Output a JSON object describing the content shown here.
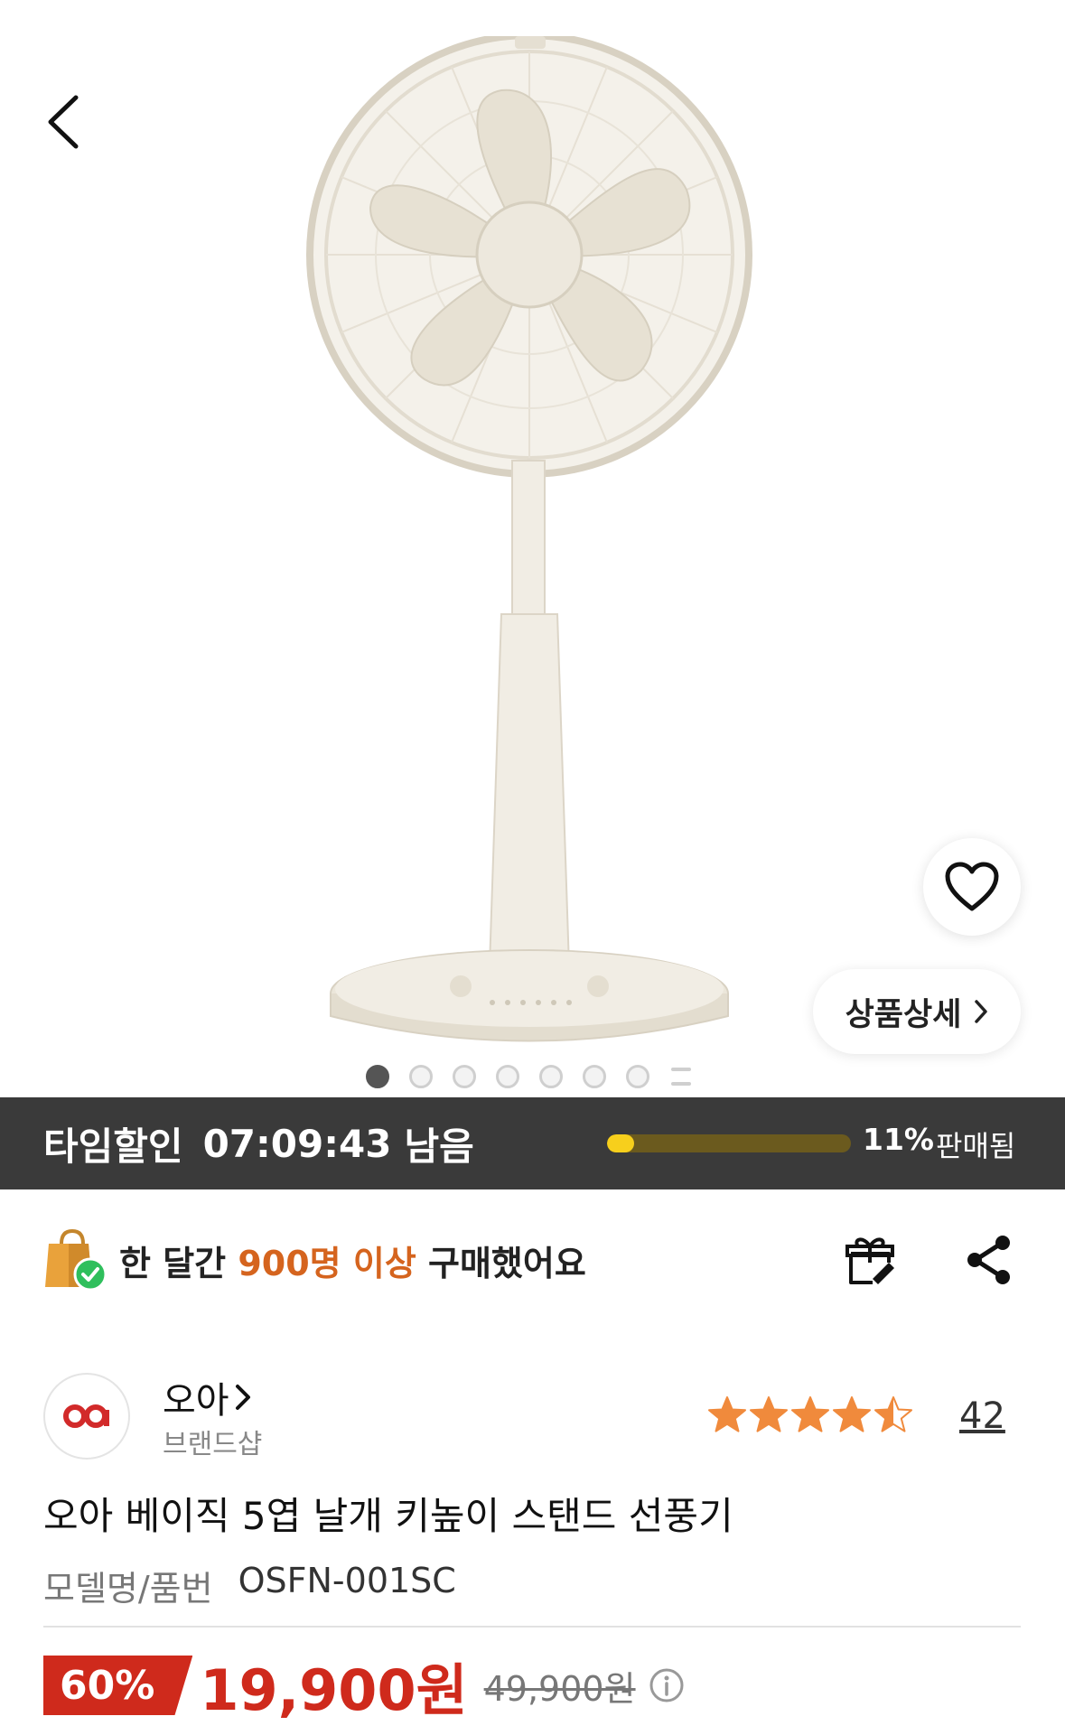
{
  "hero": {
    "image_alt": "오아 베이직 5엽 날개 키높이 스탠드 선풍기",
    "detail_button_label": "상품상세",
    "carousel": {
      "total": 7,
      "active_index": 0
    },
    "colors": {
      "fan_body": "#ece7dc",
      "fan_line": "#d8d1c2"
    }
  },
  "timesale": {
    "label": "타임할인",
    "time": "07:09:43",
    "remain": "남음",
    "sold_percent": 11,
    "sold_percent_text": "11%",
    "sold_label": "판매됨",
    "colors": {
      "bar_bg": "#3a3a3a",
      "progress_fill": "#f7cf1c",
      "progress_track": "#6b5a1e"
    }
  },
  "purchase": {
    "text_prefix": "한 달간 ",
    "text_highlight": "900명 이상",
    "text_suffix": " 구매했어요",
    "highlight_color": "#d5641e"
  },
  "brand": {
    "name": "오아",
    "subtitle": "브랜드샵",
    "logo_color": "#d22a2a"
  },
  "rating": {
    "value": 4.5,
    "max": 5,
    "review_count": "42",
    "star_color": "#f08a3c"
  },
  "product": {
    "title": "오아 베이직 5엽 날개 키높이 스탠드 선풍기",
    "model_label": "모델명/품번",
    "model_value": "OSFN-001SC"
  },
  "price": {
    "discount": "60%",
    "sale_price": "19,900원",
    "original_price": "49,900원",
    "accent_color": "#cf2a1c"
  }
}
